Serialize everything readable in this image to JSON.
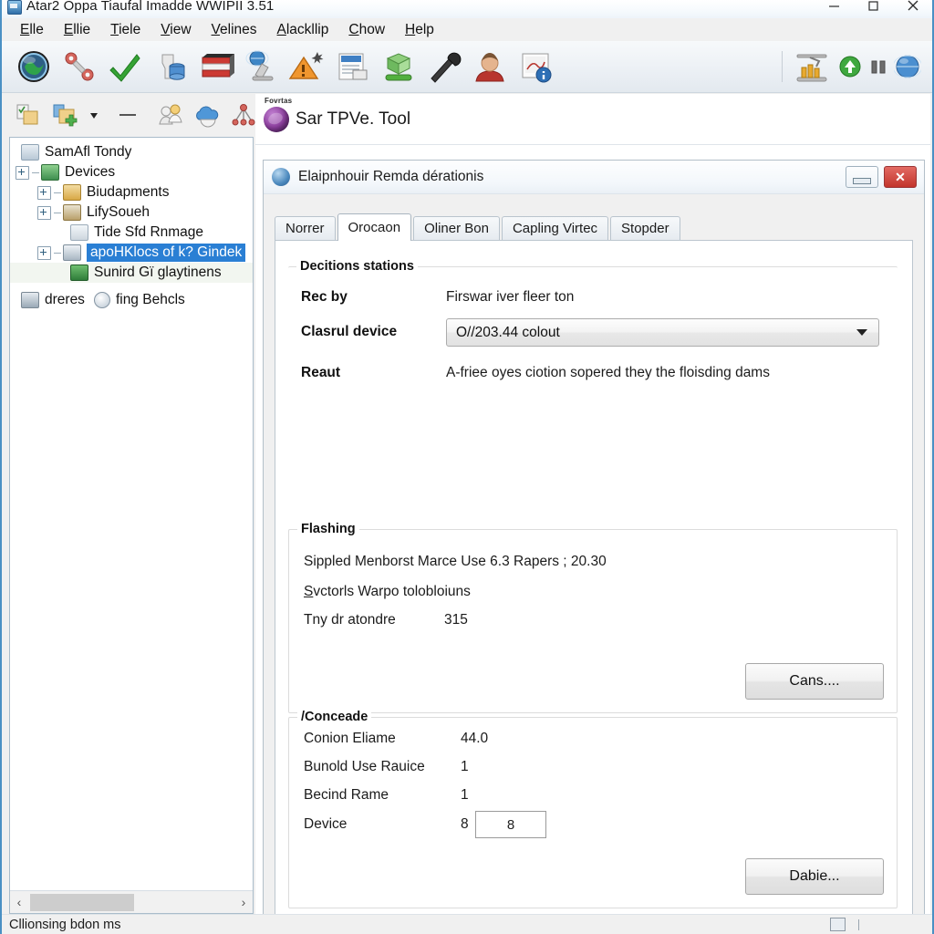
{
  "window": {
    "title": "Atar2 Oppa Tiaufal Imadde WWIPII 3.51",
    "icon": "app-icon",
    "controls": {
      "minimize": "—",
      "maximize": "☐",
      "close": "✕"
    }
  },
  "menubar": {
    "items": [
      {
        "accel": "E",
        "rest": "lle"
      },
      {
        "accel": "E",
        "rest": "llie"
      },
      {
        "accel": "T",
        "rest": "iele"
      },
      {
        "accel": "V",
        "rest": "iew"
      },
      {
        "accel": "V",
        "rest": "elines"
      },
      {
        "accel": "A",
        "rest": "lackllip"
      },
      {
        "accel": "C",
        "rest": "how"
      },
      {
        "accel": "H",
        "rest": "elp"
      }
    ]
  },
  "toolbar": {
    "icons": [
      "globe-icon",
      "gears-link-icon",
      "green-check-icon",
      "database-filter-icon",
      "book-stack-icon",
      "globe-microscope-icon",
      "warning-triangle-icon",
      "document-properties-icon",
      "package-install-icon",
      "wrench-icon",
      "user-account-icon",
      "report-info-icon"
    ],
    "right_icons": [
      "test-tubes-icon",
      "green-up-arrow-icon",
      "pause-icon",
      "blue-globe-icon"
    ]
  },
  "toolbar2": {
    "icons": [
      "new-object-icon",
      "add-object-icon",
      "dropdown-caret-icon",
      "remove-icon",
      "users-icon",
      "cloud-icon",
      "network-nodes-icon"
    ]
  },
  "tree": {
    "items": [
      {
        "label": "SamAfl Tondy",
        "depth": 0,
        "expander": false,
        "icon": "home-icon",
        "icon_color": "#b8c8d6",
        "selected": false
      },
      {
        "label": "Devices",
        "depth": 0,
        "expander": true,
        "icon": "devices-folder-icon",
        "icon_color": "#5fa35f",
        "selected": false
      },
      {
        "label": "Biudapments",
        "depth": 1,
        "expander": true,
        "icon": "folder-icon",
        "icon_color": "#d8a846",
        "selected": false
      },
      {
        "label": "LifySoueh",
        "depth": 1,
        "expander": true,
        "icon": "folder-window-icon",
        "icon_color": "#b9a06a",
        "selected": false
      },
      {
        "label": "Tide Sfd Rnmage",
        "depth": 2,
        "expander": false,
        "icon": "disk-icon",
        "icon_color": "#cdd6de",
        "selected": false
      },
      {
        "label": "apoHKlocs of k? Gindek",
        "depth": 1,
        "expander": true,
        "icon": "device-icon",
        "icon_color": "#a9b7c3",
        "selected": true
      },
      {
        "label": "Sunird Gï glaytinens",
        "depth": 2,
        "expander": false,
        "icon": "green-tile-icon",
        "icon_color": "#3e9b4e",
        "selected": false
      },
      {
        "label": "dreres",
        "depth": 0,
        "expander": false,
        "icon": "toolbox-icon",
        "icon_color": "#9aa9b6",
        "selected": false,
        "second_label": "fing Behcls",
        "second_icon": "clock-icon"
      }
    ],
    "scrollbar": {
      "left_arrow": "‹",
      "right_arrow": "›"
    }
  },
  "rightpane": {
    "small_label": "Fovrtas",
    "title": "Sar TPVe. Tool"
  },
  "dialog": {
    "title": "Elaipnhouir Remda dérationis",
    "icon": "dialog-globe-icon",
    "minimize_label": "",
    "close_label": "✕",
    "tabs": [
      {
        "label": "Norrer",
        "active": false
      },
      {
        "label": "Orocaon",
        "active": true
      },
      {
        "label": "Oliner Bon",
        "active": false
      },
      {
        "label": "Capling Virtec",
        "active": false
      },
      {
        "label": "Stopder",
        "active": false
      }
    ],
    "decisions_group": {
      "legend": "Decitions stations",
      "rec_by_label": "Rec by",
      "rec_by_value": "Firswar iver fleer ton",
      "device_label": "Clasrul device",
      "device_value": "O//203.44 colout",
      "result_label": "Reaut",
      "result_value": "A-friee oyes ciotion sopered they the floisding dams"
    },
    "flashing_group": {
      "legend": "Flashing",
      "line1": "Sippled Menborst Marce Use 6.3 Rapers ; 20.30",
      "line2_accel": "S",
      "line2_rest": "vctorls Warpo tolobloiuns",
      "line3_label": "Tny dr atondre",
      "line3_value": "315",
      "button": "Cans...."
    },
    "conceade_group": {
      "legend": "/Conceade",
      "rows": [
        {
          "label": "Conion Eliame",
          "value": "44.0"
        },
        {
          "label": "Bunold Use Rauice",
          "value": "1"
        },
        {
          "label": "Becind Rame",
          "value": "1"
        },
        {
          "label": "Device",
          "value": "8"
        }
      ],
      "field_value": "8",
      "button": "Dabie..."
    }
  },
  "statusbar": {
    "text": "Cllionsing bdon ms"
  },
  "colors": {
    "accent": "#2a7fd4",
    "window_border": "#4a90c4",
    "close_red": "#c3352c",
    "chrome": "#f0f0f0"
  }
}
